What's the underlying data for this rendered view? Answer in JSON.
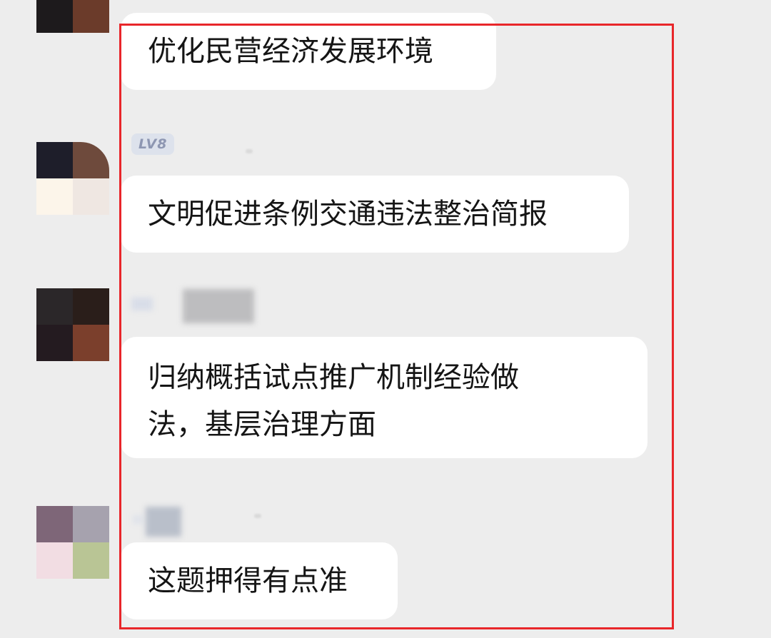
{
  "messages": [
    {
      "text": "优化民营经济发展环境"
    },
    {
      "badge": "LV8",
      "text": "文明促进条例交通违法整治简报"
    },
    {
      "text_lines": [
        "归纳概括试点推广机制经验做",
        "法，基层治理方面"
      ]
    },
    {
      "text": "这题押得有点准"
    }
  ],
  "colors": {
    "background": "#ededed",
    "bubble": "#ffffff",
    "highlight_border": "#e8262a",
    "badge_bg": "#dde2ec",
    "badge_text": "#8e97b2"
  }
}
